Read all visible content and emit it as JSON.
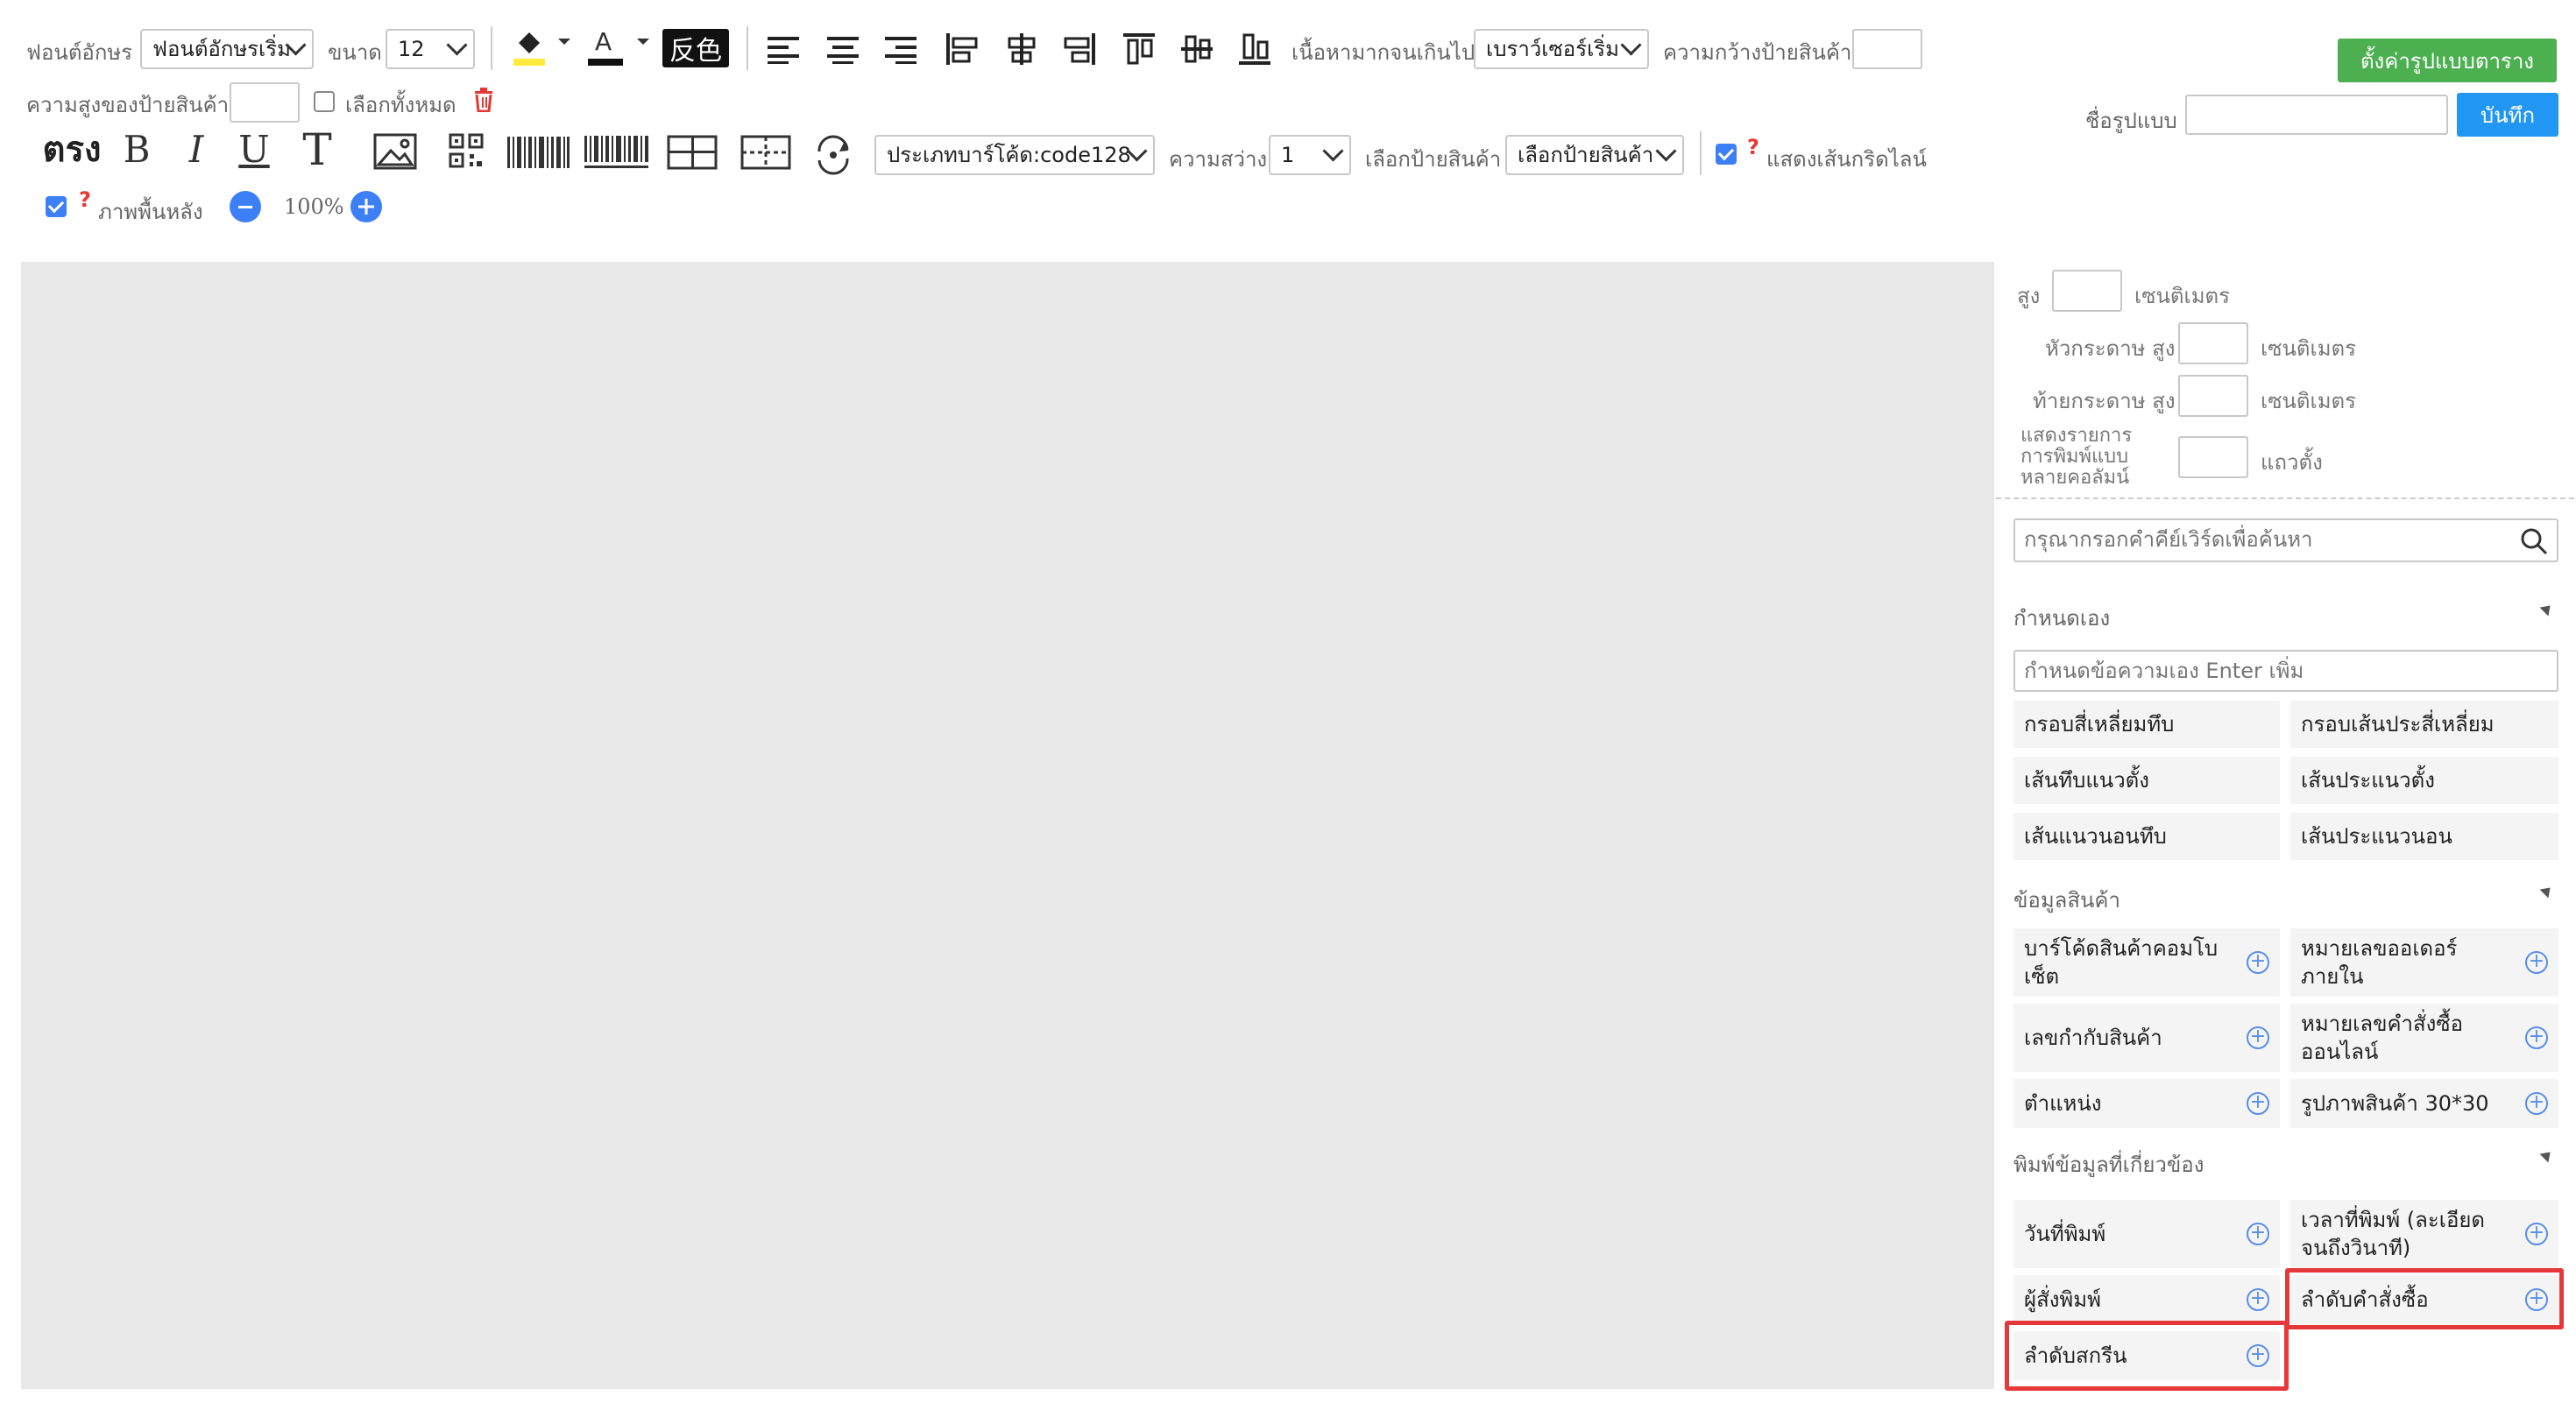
{
  "toolbar": {
    "font_label": "ฟอนต์อักษร",
    "font_value": "ฟอนต์อักษรเริ่ม",
    "size_label": "ขนาด",
    "size_value": "12",
    "invert_label": "反色",
    "overflow_label": "เนื้อหามากจนเกินไป",
    "overflow_value": "เบราว์เซอร์เริ่ม",
    "label_width_label": "ความกว้างป้ายสินค้า",
    "label_height_label": "ความสูงของป้ายสินค้า",
    "select_all_label": "เลือกทั้งหมด",
    "bold_thai_label": "ตรง",
    "bold_label": "B",
    "italic_label": "I",
    "underline_label": "U",
    "text_tool_label": "T",
    "barcode_type_value": "ประเภทบาร์โค้ด:code128",
    "brightness_label": "ความสว่าง",
    "brightness_value": "1",
    "choose_label_label": "เลือกป้ายสินค้า",
    "choose_label_value": "เลือกป้ายสินค้า",
    "show_grid_label": "แสดงเส้นกริดไลน์",
    "background_label": "ภาพพื้นหลัง",
    "zoom_value": "100%",
    "qmark": "?"
  },
  "actions": {
    "set_template_label": "ตั้งค่ารูปแบบตาราง",
    "template_name_label": "ชื่อรูปแบบ",
    "save_label": "บันทึก"
  },
  "settings": {
    "height_label": "สูง",
    "height_unit": "เซนติเมตร",
    "header_label": "หัวกระดาษ สูง",
    "header_unit": "เซนติเมตร",
    "footer_label": "ท้ายกระดาษ สูง",
    "footer_unit": "เซนติเมตร",
    "columns_label_1": "แสดงรายการ",
    "columns_label_2": "การพิมพ์แบบ",
    "columns_label_3": "หลายคอลัมน์",
    "columns_unit": "แถวตั้ง"
  },
  "search": {
    "placeholder": "กรุณากรอกคำคีย์เวิร์ดเพื่อค้นหา"
  },
  "custom_section": {
    "title": "กำหนดเอง",
    "input_placeholder": "กำหนดข้อความเอง Enter เพิ่ม",
    "items": [
      "กรอบสี่เหลี่ยมทึบ",
      "กรอบเส้นประสี่เหลี่ยม",
      "เส้นทึบแนวตั้ง",
      "เส้นประแนวตั้ง",
      "เส้นแนวนอนทึบ",
      "เส้นประแนวนอน"
    ]
  },
  "product_section": {
    "title": "ข้อมูลสินค้า",
    "items": [
      "บาร์โค้ดสินค้าคอมโบเซ็ต",
      "หมายเลขออเดอร์ภายใน",
      "เลขกำกับสินค้า",
      "หมายเลขคำสั่งซื้อออนไลน์",
      "ตำแหน่ง",
      "รูปภาพสินค้า 30*30"
    ]
  },
  "print_section": {
    "title": "พิมพ์ข้อมูลที่เกี่ยวข้อง",
    "items": [
      "วันที่พิมพ์",
      "เวลาที่พิมพ์ (ละเอียดจนถึงวินาที)",
      "ผู้สั่งพิมพ์",
      "ลำดับคำสั่งซื้อ",
      "ลำดับสกรีน"
    ]
  },
  "colors": {
    "accent_blue": "#2196f3",
    "green": "#4caf50",
    "highlight": "#e5383b"
  }
}
